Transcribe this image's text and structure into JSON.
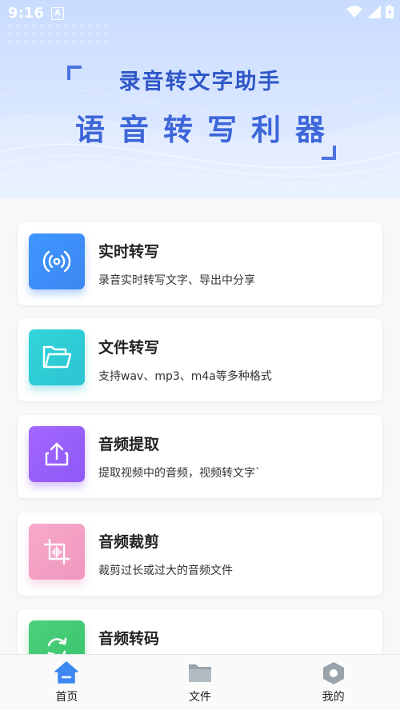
{
  "status_bar": {
    "time": "9:16",
    "notification_badge": "A"
  },
  "banner": {
    "title": "录音转文字助手",
    "subtitle": "语音转写利器"
  },
  "features": [
    {
      "title": "实时转写",
      "desc": "录音实时转写文字、导出中分享",
      "icon": "broadcast-icon",
      "color": "#3d87f2"
    },
    {
      "title": "文件转写",
      "desc": "支持wav、mp3、m4a等多种格式",
      "icon": "folder-icon",
      "color": "#2bc3d2"
    },
    {
      "title": "音频提取",
      "desc": "提取视频中的音频，视频转文字`",
      "icon": "share-upload-icon",
      "color": "#8f58f5"
    },
    {
      "title": "音频裁剪",
      "desc": "裁剪过长或过大的音频文件",
      "icon": "crop-icon",
      "color": "#ef97be"
    },
    {
      "title": "音频转码",
      "desc": "",
      "icon": "refresh-icon",
      "color": "#38c46c"
    }
  ],
  "bottom_nav": [
    {
      "label": "首页",
      "icon": "home-icon",
      "active": true
    },
    {
      "label": "文件",
      "icon": "folder-icon",
      "active": false
    },
    {
      "label": "我的",
      "icon": "profile-hexagon-icon",
      "active": false
    }
  ],
  "colors": {
    "accent": "#3d87f2",
    "banner_text": "#2f56c8"
  }
}
